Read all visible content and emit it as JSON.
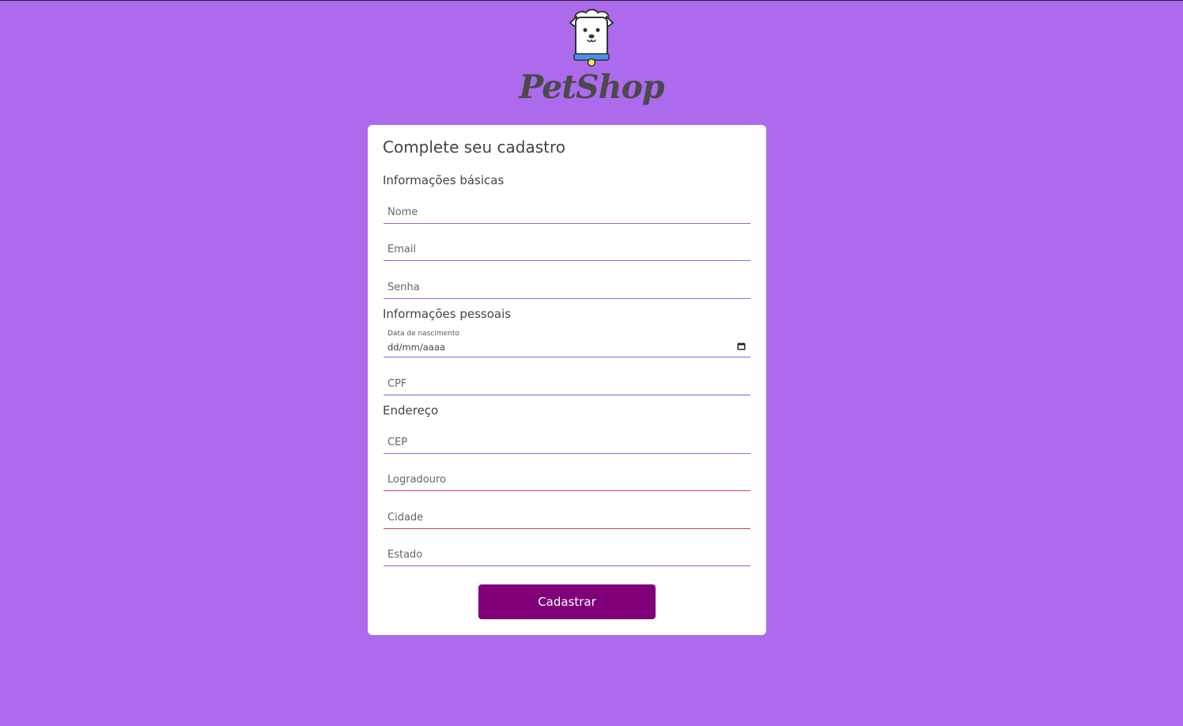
{
  "brand": {
    "name": "PetShop",
    "logo_icon": "dog-with-chef-hat"
  },
  "colors": {
    "background": "#ad6aed",
    "card": "#ffffff",
    "accent_line": "#9a5fd6",
    "button": "#7f0078"
  },
  "form": {
    "title": "Complete seu cadastro",
    "sections": {
      "basic": "Informações básicas",
      "personal": "Informações pessoais",
      "address": "Endereço"
    },
    "fields": {
      "nome": {
        "placeholder": "Nome",
        "value": ""
      },
      "email": {
        "placeholder": "Email",
        "value": ""
      },
      "senha": {
        "placeholder": "Senha",
        "value": ""
      },
      "data_nascimento": {
        "label": "Data de nascimento",
        "placeholder": "dd/mm/aaaa"
      },
      "cpf": {
        "placeholder": "CPF",
        "value": ""
      },
      "cep": {
        "placeholder": "CEP",
        "value": ""
      },
      "logradouro": {
        "placeholder": "Logradouro",
        "value": ""
      },
      "cidade": {
        "placeholder": "Cidade",
        "value": ""
      },
      "estado": {
        "placeholder": "Estado",
        "value": ""
      }
    },
    "submit_label": "Cadastrar"
  }
}
